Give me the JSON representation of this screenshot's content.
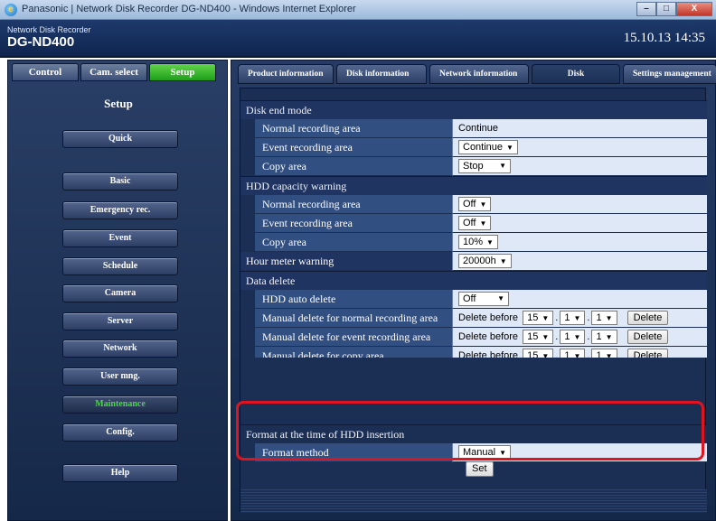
{
  "window": {
    "title": "Panasonic | Network Disk Recorder DG-ND400 - Windows Internet Explorer",
    "minimize": "–",
    "maximize": "□",
    "close": "X"
  },
  "header": {
    "brand_small": "Network Disk Recorder",
    "brand_big": "DG-ND400",
    "clock": "15.10.13  14:35"
  },
  "top_tabs": [
    {
      "label": "Control"
    },
    {
      "label": "Cam. select"
    },
    {
      "label": "Setup"
    }
  ],
  "setup_title": "Setup",
  "left_menu": [
    {
      "label": "Quick"
    },
    {
      "label": "Basic"
    },
    {
      "label": "Emergency rec."
    },
    {
      "label": "Event"
    },
    {
      "label": "Schedule"
    },
    {
      "label": "Camera"
    },
    {
      "label": "Server"
    },
    {
      "label": "Network"
    },
    {
      "label": "User mng."
    },
    {
      "label": "Maintenance"
    },
    {
      "label": "Config."
    },
    {
      "label": "Help"
    }
  ],
  "tabs": [
    {
      "label": "Product information"
    },
    {
      "label": "Disk information"
    },
    {
      "label": "Network information"
    },
    {
      "label": "Disk"
    },
    {
      "label": "Settings management"
    }
  ],
  "sections": {
    "disk_end": {
      "title": "Disk end mode",
      "normal_label": "Normal recording area",
      "normal_value": "Continue",
      "event_label": "Event recording area",
      "event_value": "Continue",
      "copy_label": "Copy area",
      "copy_value": "Stop"
    },
    "hdd_warning": {
      "title": "HDD capacity warning",
      "normal_label": "Normal recording area",
      "normal_value": "Off",
      "event_label": "Event recording area",
      "event_value": "Off",
      "copy_label": "Copy area",
      "copy_value": "10%"
    },
    "hour_meter": {
      "label": "Hour meter warning",
      "value": "20000h"
    },
    "data_delete": {
      "title": "Data delete",
      "auto_label": "HDD auto delete",
      "auto_value": "Off",
      "normal_label": "Manual delete for normal recording area",
      "event_label": "Manual delete for event recording area",
      "copy_label": "Manual delete for copy area",
      "delete_before": "Delete before",
      "d1": "15",
      "d2": "1",
      "d3": "1",
      "delete_button": "Delete"
    },
    "format": {
      "title": "Format at the time of HDD insertion",
      "method_label": "Format method",
      "method_value": "Manual"
    }
  },
  "set_button": "Set",
  "highlight_color": "#e0141e"
}
